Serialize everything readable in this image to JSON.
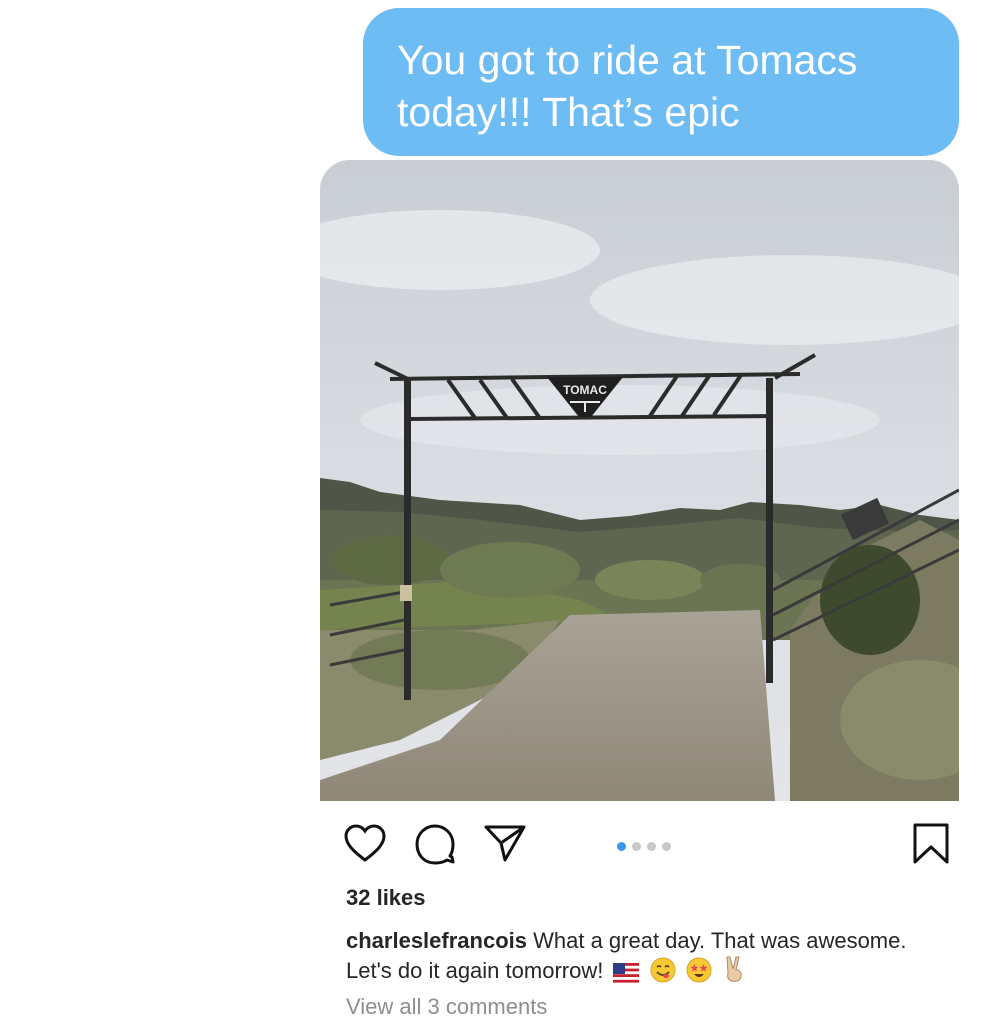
{
  "message": {
    "line1": "You got to ride at Tomacs",
    "line2": "today!!!  That’s epic",
    "bubble_color": "#6ebcf4"
  },
  "post": {
    "image_alt": "Dirt road through metal ranch gate with TOMAC sign, hills and cloudy sky",
    "gate_sign_text": "TOMAC",
    "actions": {
      "like_icon": "heart-icon",
      "comment_icon": "comment-icon",
      "share_icon": "paper-plane-icon",
      "save_icon": "bookmark-icon"
    },
    "carousel": {
      "total": 4,
      "active_index": 0,
      "active_color": "#3897f0"
    },
    "likes": "32 likes",
    "caption": {
      "username": "charleslefrancois",
      "text": "What a great day. That was awesome. Let's do it again tomorrow!",
      "emojis": [
        "flag-us-emoji",
        "yum-face-emoji",
        "star-struck-emoji",
        "victory-hand-emoji"
      ]
    },
    "view_comments": "View all 3 comments"
  }
}
